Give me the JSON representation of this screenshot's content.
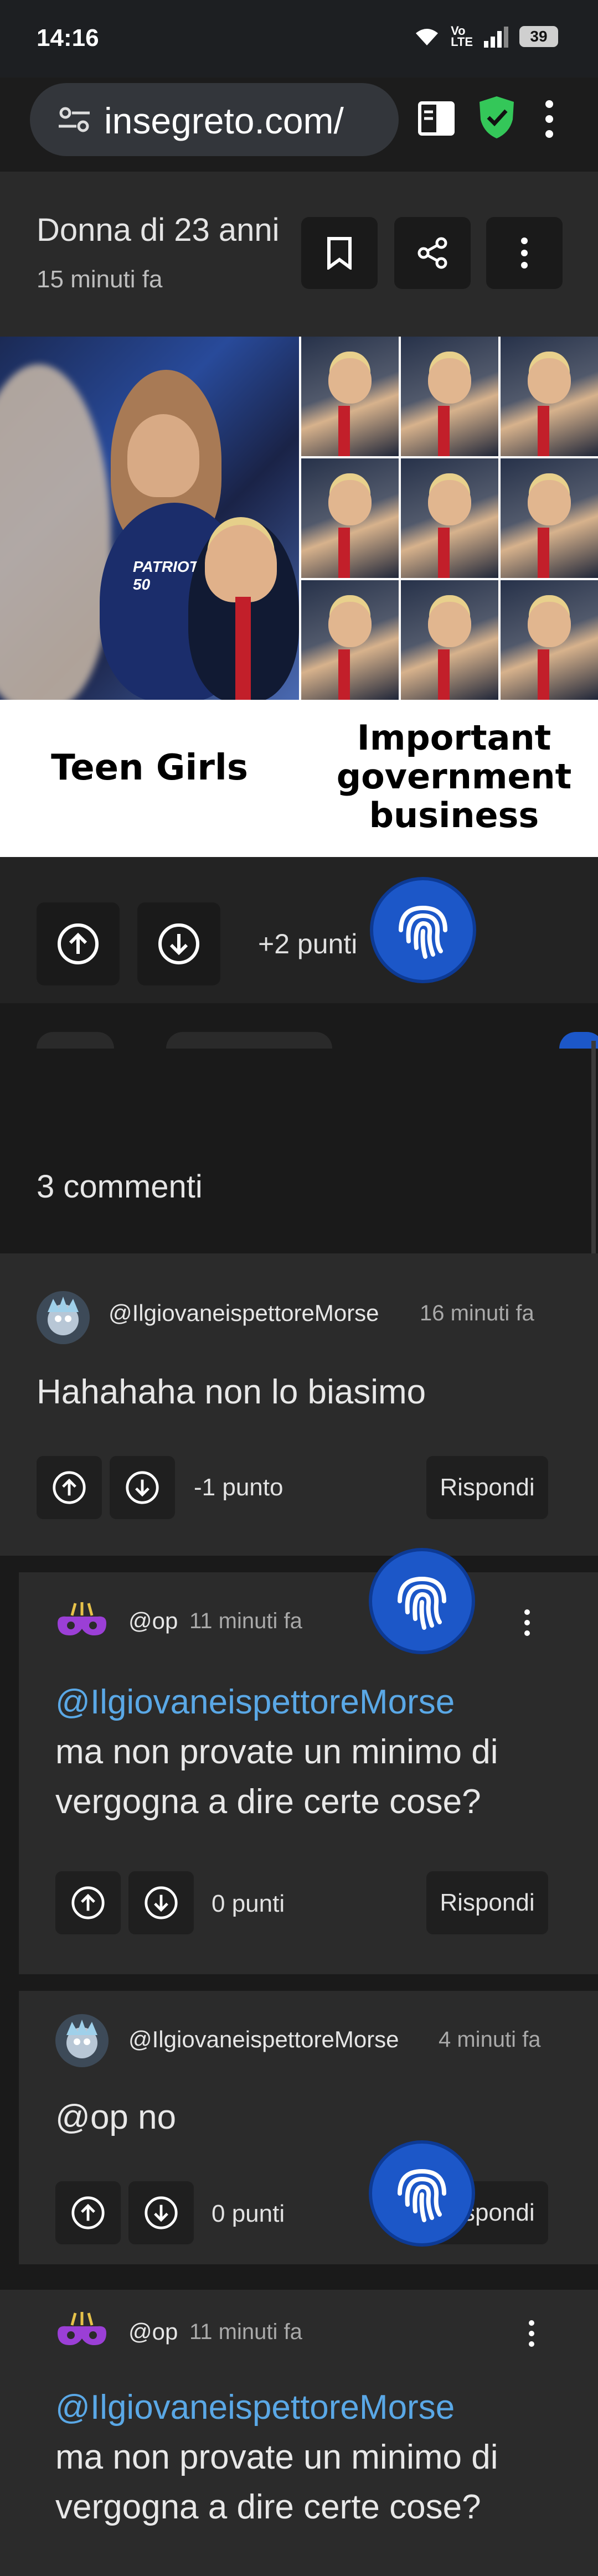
{
  "status_bar": {
    "time": "14:16",
    "volte": "Vo\nLTE",
    "battery": "39"
  },
  "browser": {
    "url": "insegreto.com/"
  },
  "post": {
    "title": "Donna di 23 anni",
    "time_ago": "15 minuti fa",
    "points": "+2 punti",
    "image": {
      "caption_left": "Teen Girls",
      "caption_right": "Important government business",
      "jersey_text": "PATRIOT 50"
    }
  },
  "comments_header": "3 commenti",
  "comments": [
    {
      "user": "@IlgiovaneispettoreMorse",
      "time": "16 minuti fa",
      "mention": "",
      "text": "Hahahaha non lo biasimo",
      "points": "-1 punto",
      "reply": "Rispondi"
    },
    {
      "user": "@op",
      "time": "11 minuti fa",
      "mention": "@IlgiovaneispettoreMorse",
      "text": "ma non provate un minimo di vergogna a dire certe cose?",
      "points": "0 punti",
      "reply": "Rispondi"
    },
    {
      "user": "@IlgiovaneispettoreMorse",
      "time": "4 minuti fa",
      "mention": "",
      "text": "@op no",
      "points": "0 punti",
      "reply": "Rispondi"
    },
    {
      "user": "@op",
      "time": "11 minuti fa",
      "mention": "@IlgiovaneispettoreMorse",
      "text": "ma non provate un minimo di vergogna a dire certe cose?"
    }
  ],
  "colors": {
    "accent_blue": "#1c57c8",
    "mention": "#5aa8e6",
    "shield_green": "#34c759",
    "background": "#1c1c1c"
  }
}
